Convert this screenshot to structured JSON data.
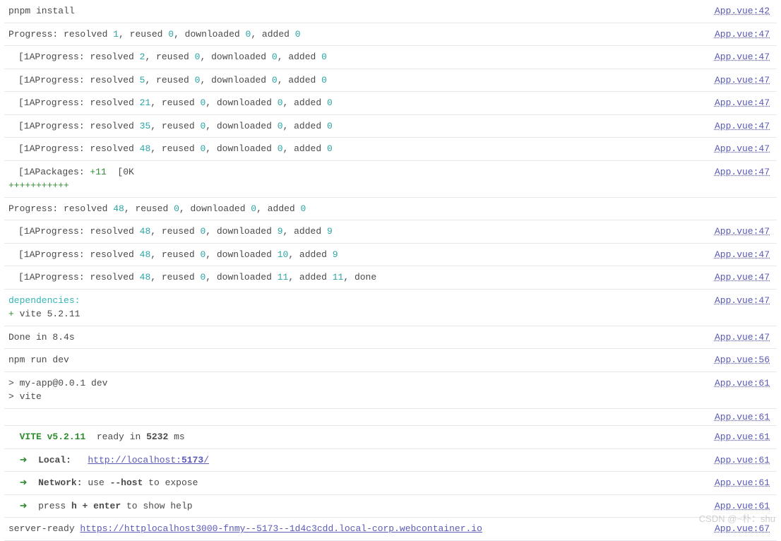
{
  "source": {
    "file": "App.vue"
  },
  "lines": [
    {
      "type": "simple",
      "indent": false,
      "text": "pnpm install",
      "loc": 42
    },
    {
      "type": "progress",
      "indent": false,
      "prefix": "Progress: ",
      "resolved": "1",
      "reused": "0",
      "downloaded": "0",
      "added": "0",
      "loc": 47
    },
    {
      "type": "progress",
      "indent": true,
      "prefix": "[1AProgress: ",
      "resolved": "2",
      "reused": "0",
      "downloaded": "0",
      "added": "0",
      "loc": 47
    },
    {
      "type": "progress",
      "indent": true,
      "prefix": "[1AProgress: ",
      "resolved": "5",
      "reused": "0",
      "downloaded": "0",
      "added": "0",
      "loc": 47
    },
    {
      "type": "progress",
      "indent": true,
      "prefix": "[1AProgress: ",
      "resolved": "21",
      "reused": "0",
      "downloaded": "0",
      "added": "0",
      "loc": 47
    },
    {
      "type": "progress",
      "indent": true,
      "prefix": "[1AProgress: ",
      "resolved": "35",
      "reused": "0",
      "downloaded": "0",
      "added": "0",
      "loc": 47
    },
    {
      "type": "progress",
      "indent": true,
      "prefix": "[1AProgress: ",
      "resolved": "48",
      "reused": "0",
      "downloaded": "0",
      "added": "0",
      "loc": 47
    },
    {
      "type": "packages",
      "indent": true,
      "prefix": "[1APackages: ",
      "delta": "+11",
      "suffix": "  [0K",
      "pluses": "+++++++++++",
      "loc": 47
    },
    {
      "type": "progress",
      "indent": false,
      "prefix": "Progress: ",
      "resolved": "48",
      "reused": "0",
      "downloaded": "0",
      "added": "0"
    },
    {
      "type": "progress",
      "indent": true,
      "prefix": "[1AProgress: ",
      "resolved": "48",
      "reused": "0",
      "downloaded": "9",
      "added": "9",
      "loc": 47
    },
    {
      "type": "progress",
      "indent": true,
      "prefix": "[1AProgress: ",
      "resolved": "48",
      "reused": "0",
      "downloaded": "10",
      "added": "9",
      "loc": 47
    },
    {
      "type": "progressDone",
      "indent": true,
      "prefix": "[1AProgress: ",
      "resolved": "48",
      "reused": "0",
      "downloaded": "11",
      "added": "11",
      "tail": ", done",
      "loc": 47
    },
    {
      "type": "deps",
      "header": "dependencies:",
      "sign": "+ ",
      "pkg": "vite 5.2.11",
      "loc": 47
    },
    {
      "type": "simple",
      "indent": false,
      "text": "Done in 8.4s",
      "loc": 47
    },
    {
      "type": "simple",
      "indent": false,
      "text": "npm run dev",
      "loc": 56
    },
    {
      "type": "multi",
      "l1": "> my-app@0.0.1 dev",
      "l2": "> vite",
      "loc": 61
    },
    {
      "type": "trunc",
      "loc": 61
    },
    {
      "type": "vite",
      "label": "VITE ",
      "version": "v5.2.11",
      "rest": "  ready in ",
      "ms": "5232",
      "tail": " ms",
      "loc": 61
    },
    {
      "type": "local",
      "arrow": "➜",
      "label": "Local:",
      "urlPrefix": "http://localhost:",
      "urlPort": "5173",
      "urlTail": "/",
      "loc": 61
    },
    {
      "type": "network",
      "arrow": "➜",
      "label": "Network:",
      "rest1": " use ",
      "flag": "--host",
      "rest2": " to expose",
      "loc": 61
    },
    {
      "type": "help",
      "arrow": "➜",
      "rest1": "press ",
      "keys": "h + enter",
      "rest2": " to show help",
      "loc": 61
    },
    {
      "type": "server",
      "label": "server-ready ",
      "url": "https://httplocalhost3000-fnmy--5173--1d4c3cdd.local-corp.webcontainer.io",
      "loc": 67
    }
  ],
  "watermark": "CSDN @~朴：shu"
}
